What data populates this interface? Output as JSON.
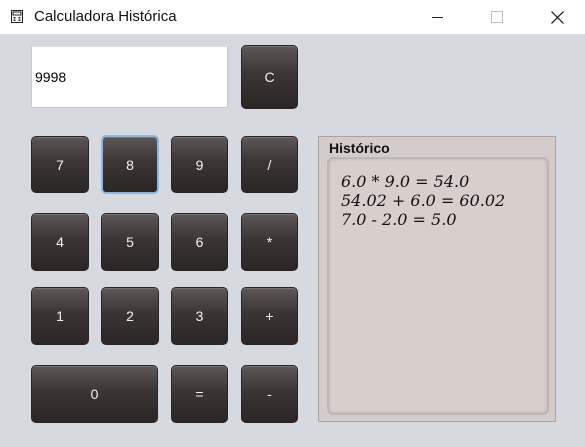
{
  "window": {
    "title": "Calculadora Histórica",
    "icon": "calculator-app-icon",
    "controls": [
      "minimize-icon",
      "maximize-icon",
      "close-icon"
    ]
  },
  "display": {
    "value": "9998"
  },
  "keys": {
    "clear": "C",
    "seven": "7",
    "eight": "8",
    "nine": "9",
    "divide": "/",
    "four": "4",
    "five": "5",
    "six": "6",
    "multiply": "*",
    "one": "1",
    "two": "2",
    "three": "3",
    "plus": "+",
    "zero": "0",
    "equals": "=",
    "minus": "-"
  },
  "history": {
    "title": "Histórico",
    "lines": [
      "6.0 * 9.0 = 54.0",
      "54.02 + 6.0 = 60.02",
      "7.0 - 2.0 = 5.0"
    ]
  },
  "colors": {
    "background": "#d6d9e0",
    "key": "#3b3535",
    "key_text": "#f2f2f2",
    "focus_ring": "#8fb7dd",
    "history_panel": "#d4cccb"
  }
}
